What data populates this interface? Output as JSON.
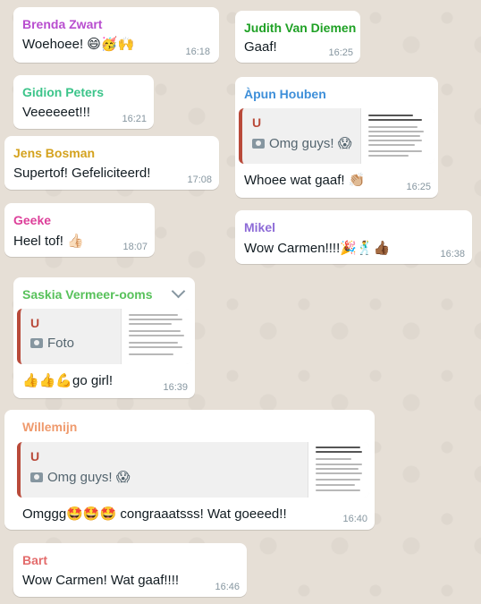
{
  "colors": {
    "brenda": "#b84dcf",
    "judith": "#1fa125",
    "gidion": "#3cc48a",
    "apun": "#3e8fd9",
    "jens": "#d4a21e",
    "geeke": "#dd3f9a",
    "mikel": "#8d6bd7",
    "saskia": "#57c15a",
    "willemijn": "#ef9a6d",
    "bart": "#e36b6b",
    "quote_accent": "#b94a3a"
  },
  "messages": {
    "brenda": {
      "sender": "Brenda Zwart",
      "text": "Woehoee! 😄🥳🙌",
      "time": "16:18"
    },
    "judith": {
      "sender": "Judith Van Diemen",
      "text": "Gaaf!",
      "time": "16:25"
    },
    "gidion": {
      "sender": "Gidion Peters",
      "text": "Veeeeeet!!!",
      "time": "16:21"
    },
    "apun": {
      "sender": "Àpun Houben",
      "quote_author": "U",
      "quote_text": "Omg guys! 😱",
      "text": "Whoee wat gaaf! 👏🏼",
      "time": "16:25"
    },
    "jens": {
      "sender": "Jens Bosman",
      "text": "Supertof! Gefeliciteerd!",
      "time": "17:08"
    },
    "geeke": {
      "sender": "Geeke",
      "text": "Heel tof! 👍🏻",
      "time": "18:07"
    },
    "mikel": {
      "sender": "Mikel",
      "text": "Wow Carmen!!!!🎉🕺👍🏾",
      "time": "16:38"
    },
    "saskia": {
      "sender": "Saskia Vermeer-ooms",
      "quote_author": "U",
      "quote_text": "Foto",
      "text": "👍👍💪go girl!",
      "time": "16:39"
    },
    "willemijn": {
      "sender": "Willemijn",
      "quote_author": "U",
      "quote_text": "Omg guys! 😱",
      "text": "Omggg🤩🤩🤩 congraaatsss! Wat goeeed!!",
      "time": "16:40"
    },
    "bart": {
      "sender": "Bart",
      "text": "Wow Carmen! Wat gaaf!!!!",
      "time": "16:46"
    }
  }
}
